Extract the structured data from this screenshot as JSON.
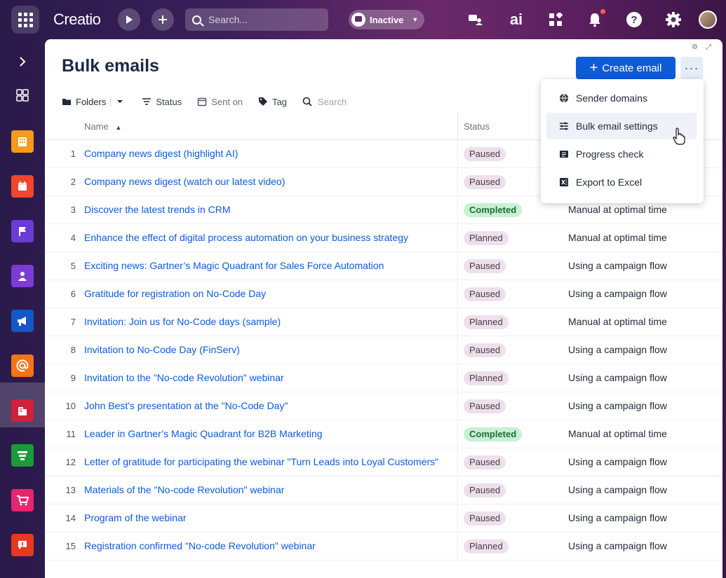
{
  "topbar": {
    "logo": "Creatio",
    "search_placeholder": "Search...",
    "status": "Inactive",
    "ai_label": "ai"
  },
  "page": {
    "title": "Bulk emails",
    "create_button": "Create email",
    "more_button": "···"
  },
  "filters": {
    "folders": "Folders",
    "status": "Status",
    "sent_on": "Sent on",
    "tag": "Tag",
    "search_placeholder": "Search"
  },
  "table": {
    "columns": {
      "name": "Name",
      "status": "Status"
    },
    "rows": [
      {
        "num": "1",
        "name": "Company news digest (highlight AI)",
        "status": "Paused",
        "status_kind": "paused",
        "type": ""
      },
      {
        "num": "2",
        "name": "Company news digest (watch our latest video)",
        "status": "Paused",
        "status_kind": "paused",
        "type": ""
      },
      {
        "num": "3",
        "name": "Discover the latest trends in CRM",
        "status": "Completed",
        "status_kind": "completed",
        "type": "Manual at optimal time"
      },
      {
        "num": "4",
        "name": "Enhance the effect of digital process automation on your business strategy",
        "status": "Planned",
        "status_kind": "planned",
        "type": "Manual at optimal time"
      },
      {
        "num": "5",
        "name": "Exciting news: Gartner’s Magic Quadrant for Sales Force Automation",
        "status": "Paused",
        "status_kind": "paused",
        "type": "Using a campaign flow"
      },
      {
        "num": "6",
        "name": "Gratitude for registration on No-Code Day",
        "status": "Paused",
        "status_kind": "paused",
        "type": "Using a campaign flow"
      },
      {
        "num": "7",
        "name": "Invitation: Join us for No-Code days (sample)",
        "status": "Planned",
        "status_kind": "planned",
        "type": "Manual at optimal time"
      },
      {
        "num": "8",
        "name": "Invitation to No-Code Day (FinServ)",
        "status": "Paused",
        "status_kind": "paused",
        "type": "Using a campaign flow"
      },
      {
        "num": "9",
        "name": "Invitation to the \"No-code Revolution\" webinar",
        "status": "Planned",
        "status_kind": "planned",
        "type": "Using a campaign flow"
      },
      {
        "num": "10",
        "name": "John Best's presentation at the \"No-Code Day\"",
        "status": "Paused",
        "status_kind": "paused",
        "type": "Using a campaign flow"
      },
      {
        "num": "11",
        "name": "Leader in Gartner’s Magic Quadrant for B2B Marketing",
        "status": "Completed",
        "status_kind": "completed",
        "type": "Manual at optimal time"
      },
      {
        "num": "12",
        "name": "Letter of gratitude for participating the webinar \"Turn Leads into Loyal Customers\"",
        "status": "Paused",
        "status_kind": "paused",
        "type": "Using a campaign flow"
      },
      {
        "num": "13",
        "name": "Materials of the \"No-code Revolution\" webinar",
        "status": "Paused",
        "status_kind": "paused",
        "type": "Using a campaign flow"
      },
      {
        "num": "14",
        "name": "Program of the webinar",
        "status": "Paused",
        "status_kind": "paused",
        "type": "Using a campaign flow"
      },
      {
        "num": "15",
        "name": "Registration confirmed \"No-code Revolution\" webinar",
        "status": "Planned",
        "status_kind": "planned",
        "type": "Using a campaign flow"
      }
    ]
  },
  "menu": {
    "items": [
      {
        "label": "Sender domains",
        "icon": "globe-icon"
      },
      {
        "label": "Bulk email settings",
        "icon": "sliders-icon"
      },
      {
        "label": "Progress check",
        "icon": "list-icon"
      },
      {
        "label": "Export to Excel",
        "icon": "excel-icon"
      }
    ],
    "hovered_index": 1
  },
  "colors": {
    "accent": "#0d5bd6",
    "completed_bg": "#c8f0d3",
    "paused_bg": "#eee0ea"
  },
  "nav_icons": [
    "expand-icon",
    "dashboard-icon",
    "building-icon",
    "calendar-icon",
    "flag-icon",
    "contact-icon",
    "megaphone-icon",
    "email-icon",
    "account-icon",
    "funnel-icon",
    "cart-icon",
    "alert-icon"
  ]
}
